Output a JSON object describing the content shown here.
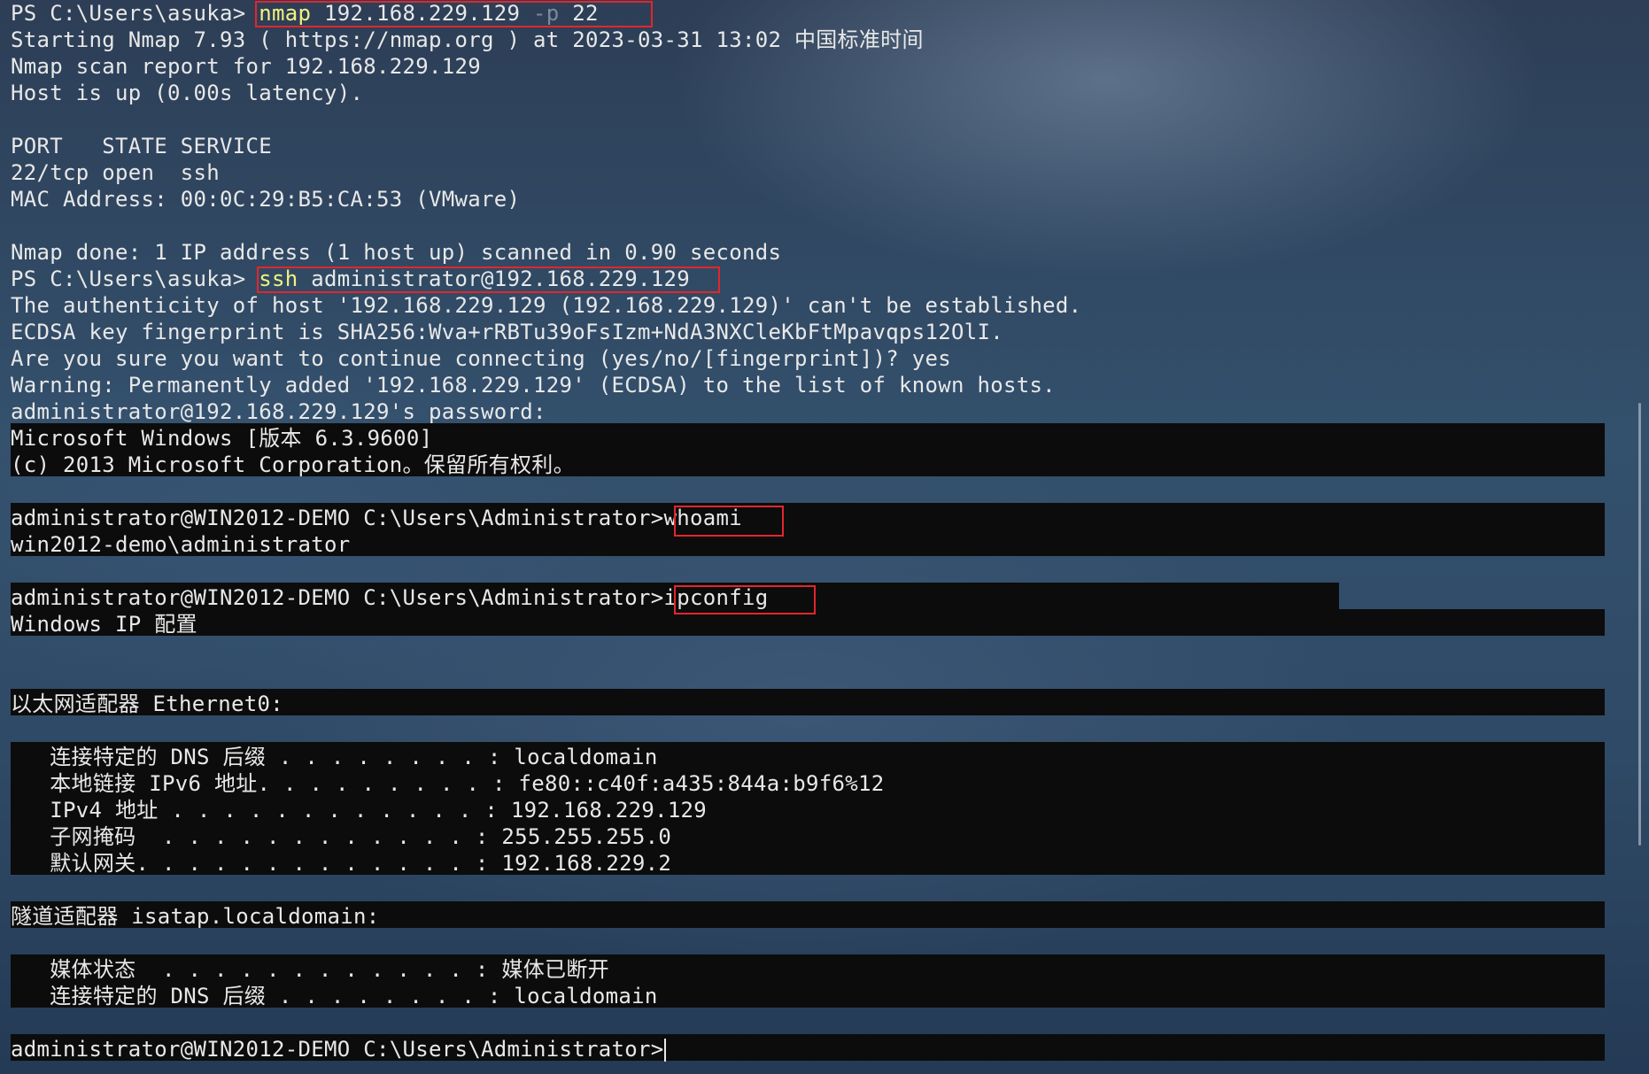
{
  "prompt_ps": "PS C:\\Users\\asuka> ",
  "cmd_nmap": {
    "name": "nmap",
    "target": " 192.168.229.129 ",
    "flag": "-p",
    "port": " 22"
  },
  "nmap_output": [
    "Starting Nmap 7.93 ( https://nmap.org ) at 2023-03-31 13:02 中国标准时间",
    "Nmap scan report for 192.168.229.129",
    "Host is up (0.00s latency).",
    "",
    "PORT   STATE SERVICE",
    "22/tcp open  ssh",
    "MAC Address: 00:0C:29:B5:CA:53 (VMware)",
    "",
    "Nmap done: 1 IP address (1 host up) scanned in 0.90 seconds"
  ],
  "cmd_ssh": {
    "name": "ssh",
    "args": " administrator@192.168.229.129"
  },
  "ssh_output": [
    "The authenticity of host '192.168.229.129 (192.168.229.129)' can't be established.",
    "ECDSA key fingerprint is SHA256:Wva+rRBTu39oFsIzm+NdA3NXCleKbFtMpavqps12OlI.",
    "Are you sure you want to continue connecting (yes/no/[fingerprint])? yes",
    "Warning: Permanently added '192.168.229.129' (ECDSA) to the list of known hosts.",
    "administrator@192.168.229.129's password:"
  ],
  "windows_banner": [
    "Microsoft Windows [版本 6.3.9600]",
    "(c) 2013 Microsoft Corporation。保留所有权利。"
  ],
  "prompt_remote": "administrator@WIN2012-DEMO C:\\Users\\Administrator>",
  "cmd_whoami": "whoami",
  "whoami_output": "win2012-demo\\administrator",
  "cmd_ipconfig": "ipconfig",
  "ipconfig_output": {
    "title": "Windows IP 配置",
    "adapter1_header": "以太网适配器 Ethernet0:",
    "adapter1_lines": [
      "   连接特定的 DNS 后缀 . . . . . . . . : localdomain",
      "   本地链接 IPv6 地址. . . . . . . . . : fe80::c40f:a435:844a:b9f6%12",
      "   IPv4 地址 . . . . . . . . . . . . : 192.168.229.129",
      "   子网掩码  . . . . . . . . . . . . : 255.255.255.0",
      "   默认网关. . . . . . . . . . . . . : 192.168.229.2"
    ],
    "adapter2_header": "隧道适配器 isatap.localdomain:",
    "adapter2_lines": [
      "   媒体状态  . . . . . . . . . . . . : 媒体已断开",
      "   连接特定的 DNS 后缀 . . . . . . . . : localdomain"
    ]
  },
  "colors": {
    "highlight_box": "#e3262b",
    "command_yellow": "#f3f17e",
    "terminal_black": "#0c0c0c",
    "text": "#e8e8e8"
  }
}
